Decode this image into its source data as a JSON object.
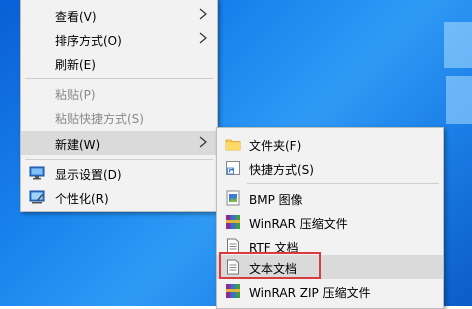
{
  "context_menu": {
    "items": [
      {
        "label": "查看(V)",
        "has_submenu": true,
        "enabled": true
      },
      {
        "label": "排序方式(O)",
        "has_submenu": true,
        "enabled": true
      },
      {
        "label": "刷新(E)",
        "has_submenu": false,
        "enabled": true
      },
      {
        "label": "粘贴(P)",
        "has_submenu": false,
        "enabled": false
      },
      {
        "label": "粘贴快捷方式(S)",
        "has_submenu": false,
        "enabled": false
      },
      {
        "label": "新建(W)",
        "has_submenu": true,
        "enabled": true,
        "highlighted": true
      },
      {
        "label": "显示设置(D)",
        "icon": "display-settings-icon",
        "enabled": true
      },
      {
        "label": "个性化(R)",
        "icon": "personalize-icon",
        "enabled": true
      }
    ]
  },
  "new_submenu": {
    "items": [
      {
        "label": "文件夹(F)",
        "icon": "folder-icon"
      },
      {
        "label": "快捷方式(S)",
        "icon": "shortcut-icon"
      },
      {
        "label": "BMP 图像",
        "icon": "bmp-image-icon"
      },
      {
        "label": "WinRAR 压缩文件",
        "icon": "winrar-archive-icon"
      },
      {
        "label": "RTF 文档",
        "icon": "rtf-document-icon"
      },
      {
        "label": "文本文档",
        "icon": "text-document-icon",
        "highlighted": true,
        "outlined": true
      },
      {
        "label": "WinRAR ZIP 压缩文件",
        "icon": "winrar-zip-icon"
      }
    ]
  },
  "colors": {
    "desktop_background": "#1a86ee",
    "menu_background": "#f2f2f2",
    "highlight_background": "#dadada",
    "annotation_box": "#d93c3c",
    "disabled_text": "#8a8a8a"
  }
}
